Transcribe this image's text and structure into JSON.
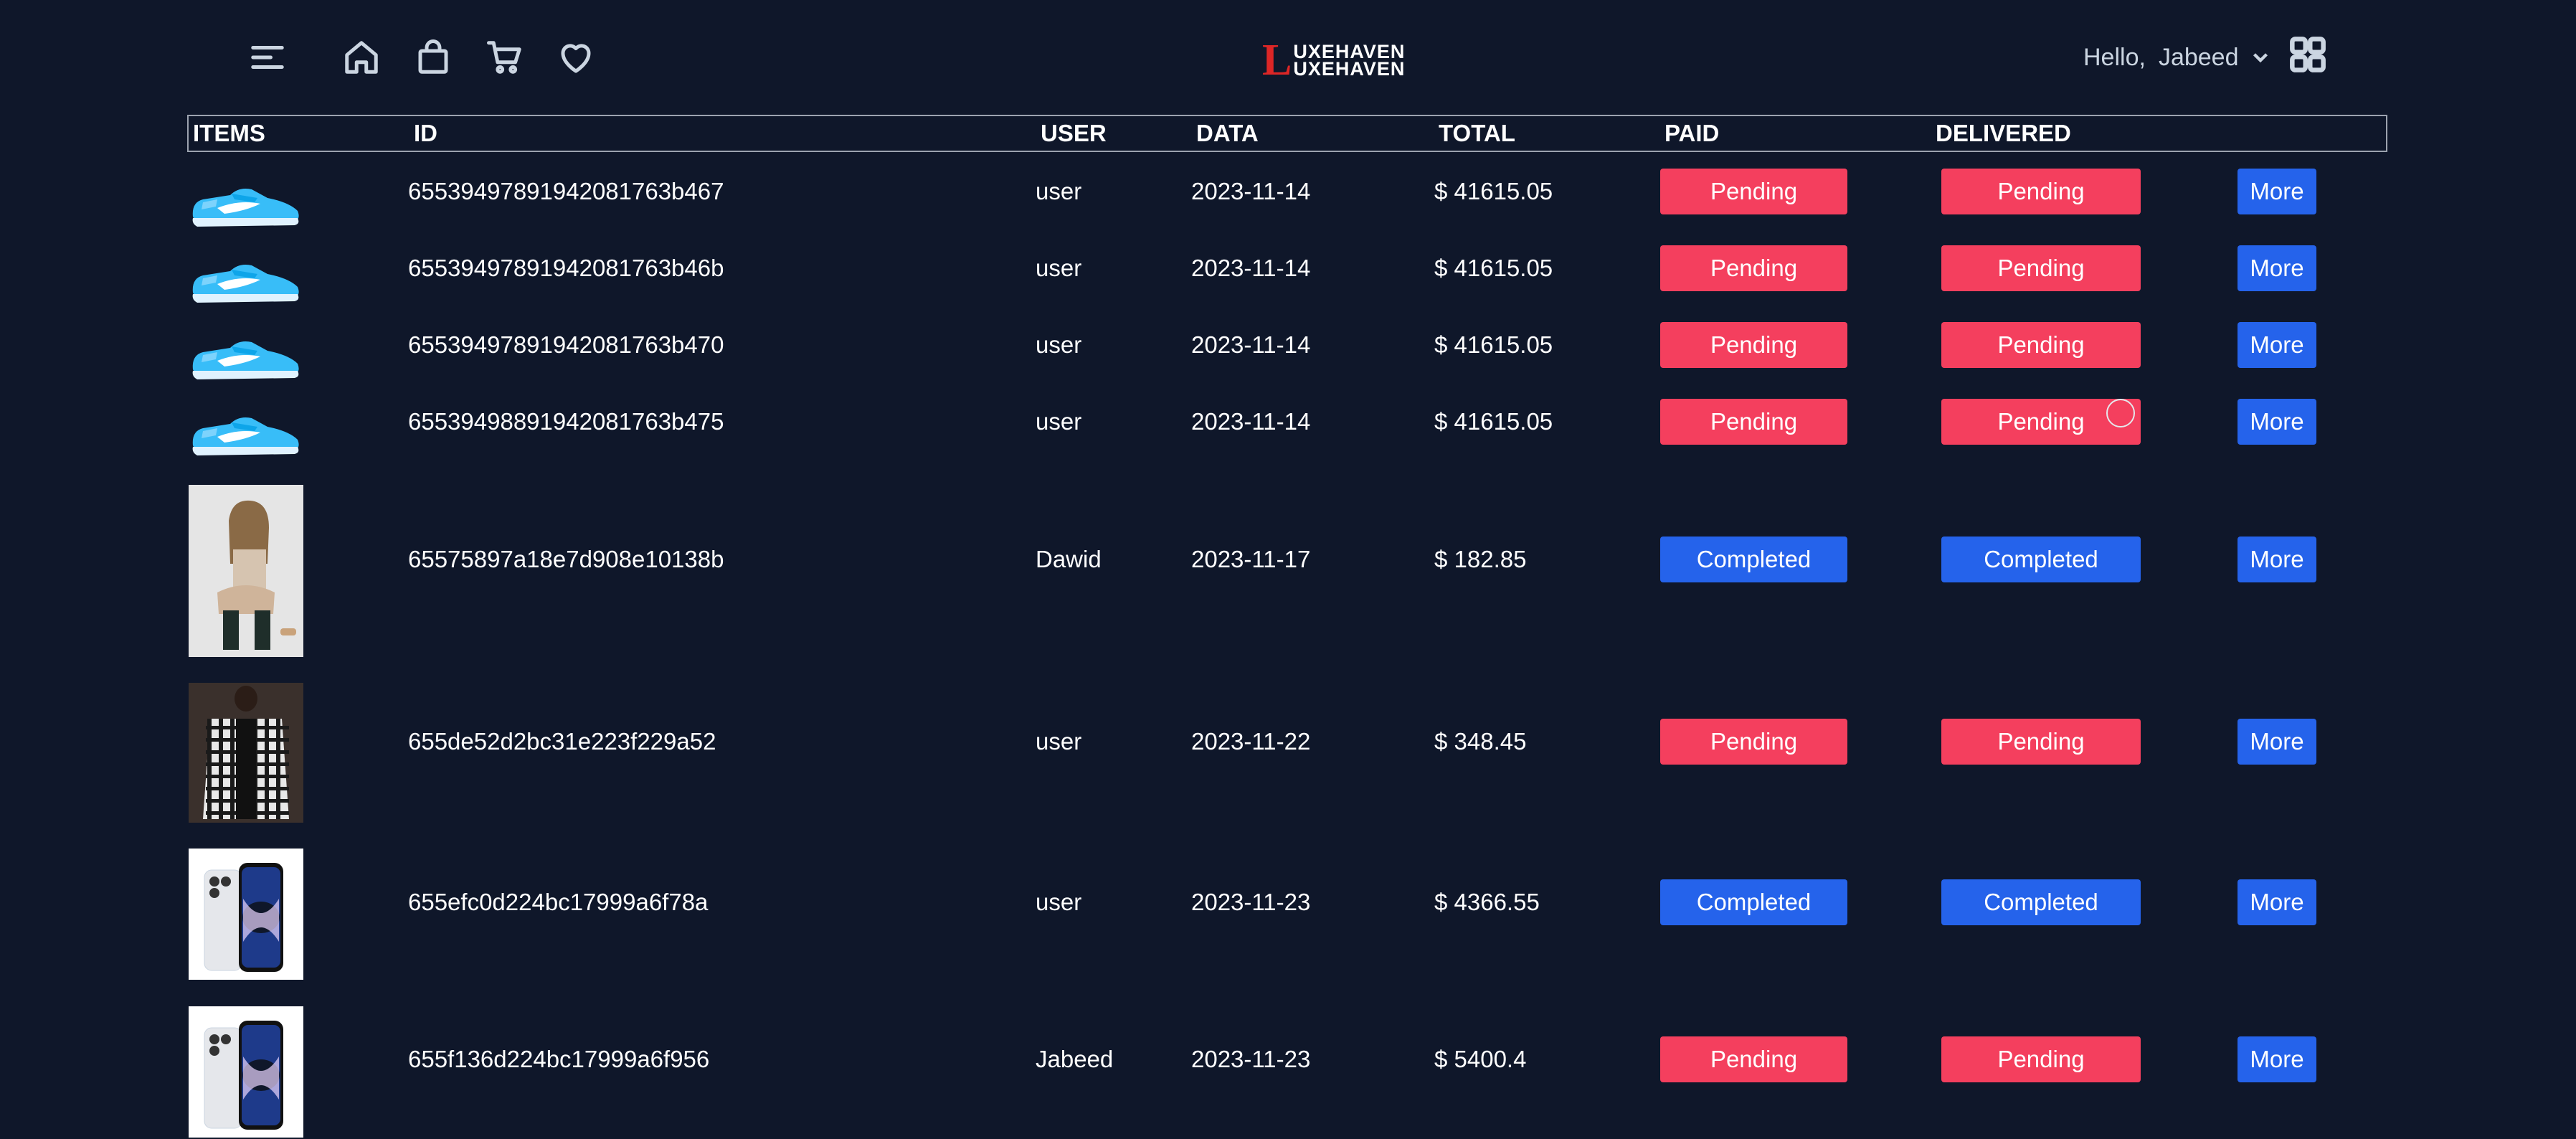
{
  "nav": {
    "icons": [
      "menu-icon",
      "home-icon",
      "shopping-bag-icon",
      "cart-icon",
      "heart-icon"
    ],
    "logo_initial": "L",
    "logo_line1": "UXEHAVEN",
    "logo_line2": "UXEHAVEN",
    "greeting": "Hello,",
    "user_name": "Jabeed",
    "grid_icon": "grid-icon"
  },
  "table": {
    "headers": {
      "items": "ITEMS",
      "id": "ID",
      "user": "USER",
      "data": "DATA",
      "total": "TOTAL",
      "paid": "PAID",
      "delivered": "DELIVERED"
    },
    "more_label": "More",
    "rows": [
      {
        "image": "blue-sneaker",
        "id": "65539497891942081763b467",
        "user": "user",
        "date": "2023-11-14",
        "total": "$ 41615.05",
        "paid": "Pending",
        "delivered": "Pending"
      },
      {
        "image": "blue-sneaker",
        "id": "65539497891942081763b46b",
        "user": "user",
        "date": "2023-11-14",
        "total": "$ 41615.05",
        "paid": "Pending",
        "delivered": "Pending"
      },
      {
        "image": "blue-sneaker",
        "id": "65539497891942081763b470",
        "user": "user",
        "date": "2023-11-14",
        "total": "$ 41615.05",
        "paid": "Pending",
        "delivered": "Pending"
      },
      {
        "image": "blue-sneaker",
        "id": "65539498891942081763b475",
        "user": "user",
        "date": "2023-11-14",
        "total": "$ 41615.05",
        "paid": "Pending",
        "delivered": "Pending"
      },
      {
        "image": "woman-photo",
        "id": "65575897a18e7d908e10138b",
        "user": "Dawid",
        "date": "2023-11-17",
        "total": "$ 182.85",
        "paid": "Completed",
        "delivered": "Completed"
      },
      {
        "image": "plaid-shirt-photo",
        "id": "655de52d2bc31e223f229a52",
        "user": "user",
        "date": "2023-11-22",
        "total": "$ 348.45",
        "paid": "Pending",
        "delivered": "Pending"
      },
      {
        "image": "iphone-photo",
        "id": "655efc0d224bc17999a6f78a",
        "user": "user",
        "date": "2023-11-23",
        "total": "$ 4366.55",
        "paid": "Completed",
        "delivered": "Completed"
      },
      {
        "image": "iphone-photo",
        "id": "655f136d224bc17999a6f956",
        "user": "Jabeed",
        "date": "2023-11-23",
        "total": "$ 5400.4",
        "paid": "Pending",
        "delivered": "Pending"
      }
    ]
  },
  "colors": {
    "background": "#0f172a",
    "pending": "#f43f5e",
    "completed": "#2563eb",
    "logo_accent": "#dc2626"
  }
}
